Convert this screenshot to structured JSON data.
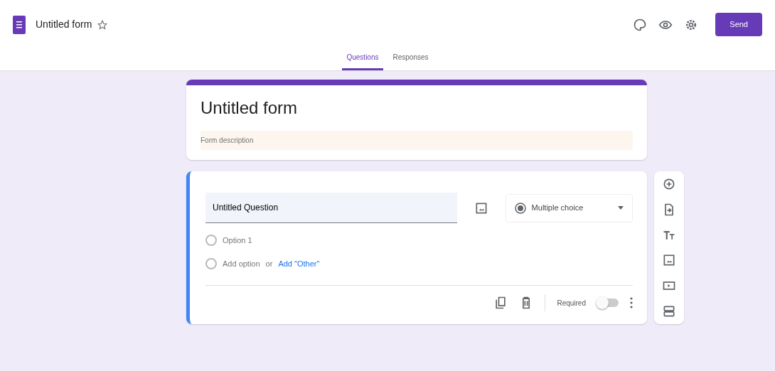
{
  "header": {
    "title": "Untitled form",
    "starred": false,
    "send_label": "Send"
  },
  "tabs": [
    {
      "label": "Questions",
      "selected": true
    },
    {
      "label": "Responses",
      "selected": false
    }
  ],
  "form": {
    "title": "Untitled form",
    "description_placeholder": "Form description"
  },
  "question": {
    "title": "Untitled Question",
    "type": "Multiple choice",
    "options": [
      {
        "label": "Option 1",
        "selected": false
      }
    ],
    "add_row": {
      "selected": false,
      "add_option": "Add option",
      "or": "or",
      "add_other": "Add \"Other\""
    },
    "required_label": "Required",
    "required": false
  }
}
